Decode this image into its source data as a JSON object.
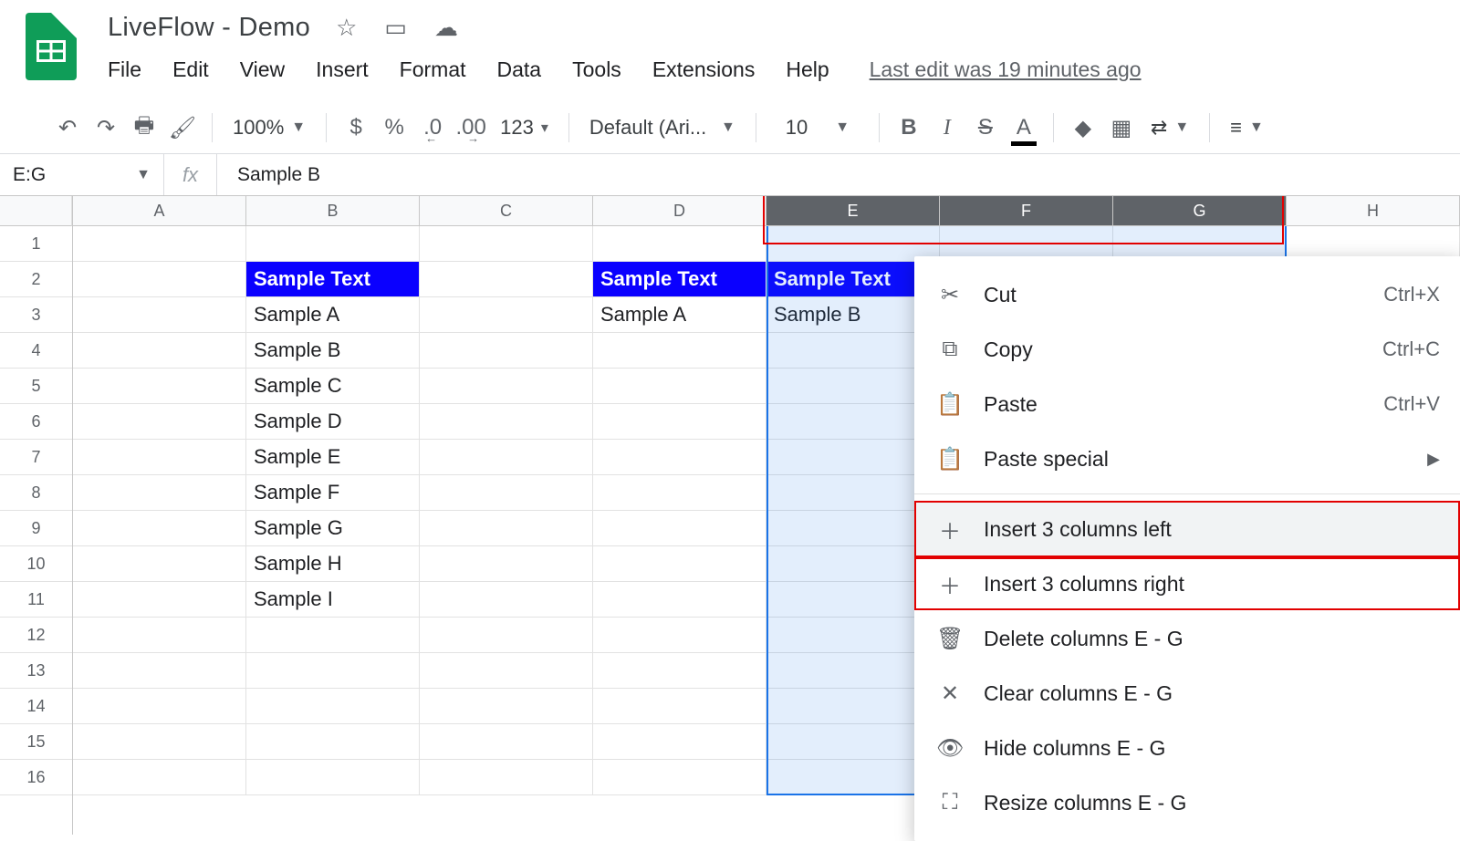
{
  "doc": {
    "title": "LiveFlow - Demo"
  },
  "menubar": [
    "File",
    "Edit",
    "View",
    "Insert",
    "Format",
    "Data",
    "Tools",
    "Extensions",
    "Help"
  ],
  "last_edit": "Last edit was 19 minutes ago",
  "toolbar": {
    "zoom": "100%",
    "currency": "$",
    "percent": "%",
    "dec_dec": ".0",
    "inc_dec": ".00",
    "numfmt": "123",
    "font": "Default (Ari...",
    "font_size": "10",
    "bold": "B",
    "italic": "I",
    "strike": "S",
    "textcolor": "A"
  },
  "namebox": "E:G",
  "fxvalue": "Sample B",
  "columns": [
    "A",
    "B",
    "C",
    "D",
    "E",
    "F",
    "G",
    "H"
  ],
  "selected_columns": [
    "E",
    "F",
    "G"
  ],
  "rows": 16,
  "cells": {
    "2": {
      "B": "Sample Text",
      "D": "Sample Text",
      "E": "Sample Text"
    },
    "3": {
      "B": "Sample A",
      "D": "Sample A",
      "E": "Sample B"
    },
    "4": {
      "B": "Sample B"
    },
    "5": {
      "B": "Sample C"
    },
    "6": {
      "B": "Sample D"
    },
    "7": {
      "B": "Sample E"
    },
    "8": {
      "B": "Sample F"
    },
    "9": {
      "B": "Sample G"
    },
    "10": {
      "B": "Sample H"
    },
    "11": {
      "B": "Sample I"
    }
  },
  "header_cells": [
    "B2",
    "D2",
    "E2"
  ],
  "context_menu": {
    "items": [
      {
        "icon": "scissors-icon",
        "label": "Cut",
        "shortcut": "Ctrl+X"
      },
      {
        "icon": "copy-icon",
        "label": "Copy",
        "shortcut": "Ctrl+C"
      },
      {
        "icon": "clipboard-icon",
        "label": "Paste",
        "shortcut": "Ctrl+V"
      },
      {
        "icon": "clipboard-icon",
        "label": "Paste special",
        "submenu": true
      },
      {
        "sep": true
      },
      {
        "icon": "plus-icon",
        "label": "Insert 3 columns left",
        "hover": true
      },
      {
        "icon": "plus-icon",
        "label": "Insert 3 columns right"
      },
      {
        "icon": "trash-icon",
        "label": "Delete columns E - G"
      },
      {
        "icon": "close-icon",
        "label": "Clear columns E - G"
      },
      {
        "icon": "hide-icon",
        "label": "Hide columns E - G"
      },
      {
        "icon": "resize-icon",
        "label": "Resize columns E - G"
      }
    ]
  }
}
